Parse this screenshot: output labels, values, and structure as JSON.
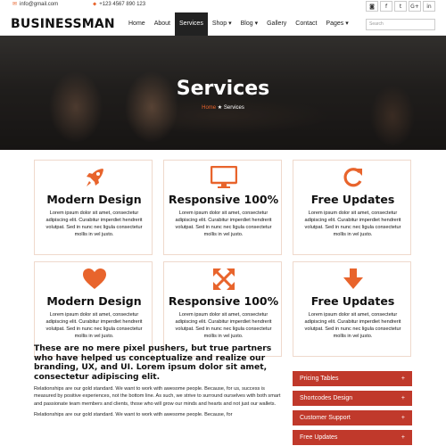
{
  "topbar": {
    "email": "info@gmail.com",
    "phone": "+123 4567 890 123",
    "socials": [
      {
        "icon": "rss-icon",
        "glyph": "◙"
      },
      {
        "icon": "facebook-icon",
        "glyph": "f"
      },
      {
        "icon": "twitter-icon",
        "glyph": "t"
      },
      {
        "icon": "google-plus-icon",
        "glyph": "G+"
      },
      {
        "icon": "linkedin-icon",
        "glyph": "in"
      }
    ]
  },
  "header": {
    "logo": "BUSINESSMAN",
    "nav": [
      "Home",
      "About",
      "Services",
      "Shop ▾",
      "Blog ▾",
      "Gallery",
      "Contact",
      "Pages ▾"
    ],
    "active_nav": "Services",
    "search_placeholder": "Search"
  },
  "hero": {
    "title": "Services",
    "crumb_home": "Home",
    "crumb_sep": "★",
    "crumb_current": "Services"
  },
  "services": [
    {
      "icon": "rocket-icon",
      "title": "Modern Design",
      "desc": "Lorem ipsum dolor sit amet, consectetur adipiscing elit. Curabitur imperdiet hendrerit volutpat. Sed in nunc nec ligula consectetur mollis in vel justo."
    },
    {
      "icon": "monitor-icon",
      "title": "Responsive 100%",
      "desc": "Lorem ipsum dolor sit amet, consectetur adipiscing elit. Curabitur imperdiet hendrerit volutpat. Sed in nunc nec ligula consectetur mollis in vel justo."
    },
    {
      "icon": "refresh-icon",
      "title": "Free Updates",
      "desc": "Lorem ipsum dolor sit amet, consectetur adipiscing elit. Curabitur imperdiet hendrerit volutpat. Sed in nunc nec ligula consectetur mollis in vel justo."
    },
    {
      "icon": "heart-icon",
      "title": "Modern Design",
      "desc": "Lorem ipsum dolor sit amet, consectetur adipiscing elit. Curabitur imperdiet hendrerit volutpat. Sed in nunc nec ligula consectetur mollis in vel justo."
    },
    {
      "icon": "expand-arrows-icon",
      "title": "Responsive 100%",
      "desc": "Lorem ipsum dolor sit amet, consectetur adipiscing elit. Curabitur imperdiet hendrerit volutpat. Sed in nunc nec ligula consectetur mollis in vel justo."
    },
    {
      "icon": "arrow-down-icon",
      "title": "Free Updates",
      "desc": "Lorem ipsum dolor sit amet, consectetur adipiscing elit. Curabitur imperdiet hendrerit volutpat. Sed in nunc nec ligula consectetur mollis in vel justo."
    }
  ],
  "about": {
    "heading": "These are no mere pixel pushers, but true partners who have helped us conceptualize and realize our branding, UX, and UI. Lorem ipsum dolor sit amet, consectetur adipiscing elit.",
    "para1": "Relationships are our gold standard. We want to work with awesome people. Because, for us, success is measured by positive experiences, not the bottom line. As such, we strive to surround ourselves with both smart and passionate team members and clients, those who will grow our minds and hearts and not just our wallets.",
    "para2": "Relationships are our gold standard. We want to work with awesome people. Because, for"
  },
  "accordion": [
    {
      "label": "Pricing Tables",
      "toggle": "+"
    },
    {
      "label": "Shortcodes Design",
      "toggle": "+"
    },
    {
      "label": "Customer Support",
      "toggle": "+"
    },
    {
      "label": "Free Updates",
      "toggle": "+"
    }
  ],
  "colors": {
    "accent": "#e8642c",
    "accordion": "#c0392b",
    "nav_active": "#222222"
  }
}
